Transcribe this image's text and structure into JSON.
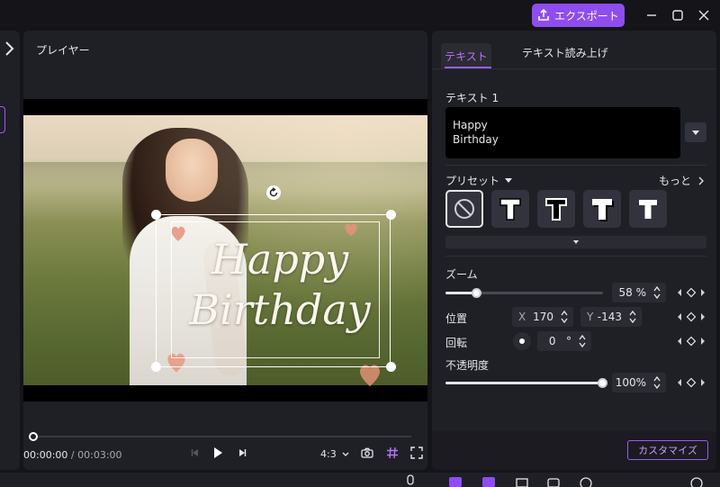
{
  "titlebar": {
    "export_label": "エクスポート"
  },
  "player": {
    "title": "プレイヤー",
    "overlay_text_line1": "Happy",
    "overlay_text_line2": "Birthday",
    "time_current": "00:00:00",
    "time_separator": "/",
    "time_total": "00:03:00",
    "aspect_ratio": "4:3",
    "playhead_position": 0.0
  },
  "panel": {
    "tabs": [
      {
        "label": "テキスト",
        "active": true
      },
      {
        "label": "テキスト読み上げ",
        "active": false
      }
    ],
    "text_section_label": "テキスト 1",
    "text_value_line1": "Happy",
    "text_value_line2": "Birthday",
    "preset_label": "プリセット",
    "more_label": "もっと",
    "presets": [
      "none",
      "T-bold-white",
      "T-outline-black",
      "T-shadow",
      "T-plain"
    ],
    "zoom_label": "ズーム",
    "zoom_value": "58",
    "zoom_unit": "%",
    "zoom_fraction": 0.2,
    "position_label": "位置",
    "x_label": "X",
    "x_value": "170",
    "y_label": "Y",
    "y_value": "-143",
    "rotation_label": "回転",
    "rotation_value": "0",
    "rotation_unit": "°",
    "opacity_label": "不透明度",
    "opacity_value": "100%",
    "opacity_fraction": 1.0,
    "customize_label": "カスタマイズ"
  },
  "colors": {
    "accent": "#8e4df0",
    "panel_bg": "#1f1f26",
    "app_bg": "#141419"
  }
}
